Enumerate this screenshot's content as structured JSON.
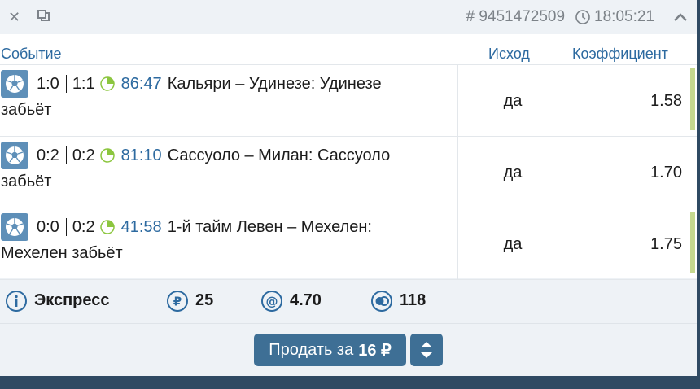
{
  "header": {
    "close_icon": "close-icon",
    "copy_icon": "copy-icon",
    "bet_id": "# 9451472509",
    "time": "18:05:21",
    "collapse_icon": "chevron-up-icon"
  },
  "columns": {
    "event": "Событие",
    "outcome": "Исход",
    "coefficient": "Коэффициент"
  },
  "rows": [
    {
      "score1": "1:0",
      "score2": "1:1",
      "minute": "86:47",
      "title": "Кальяри – Удинезе: Удинезе",
      "title2": "забьёт",
      "outcome": "да",
      "coef": "1.58"
    },
    {
      "score1": "0:2",
      "score2": "0:2",
      "minute": "81:10",
      "title": "Сассуоло – Милан: Сассуоло",
      "title2": "забьёт",
      "outcome": "да",
      "coef": "1.70"
    },
    {
      "score1": "0:0",
      "score2": "0:2",
      "minute": "41:58",
      "title": "1-й тайм Левен – Мехелен:",
      "title2": "Мехелен забьёт",
      "outcome": "да",
      "coef": "1.75"
    }
  ],
  "footer": {
    "type": "Экспресс",
    "stake": "25",
    "total_coef": "4.70",
    "count": "118"
  },
  "actions": {
    "sell_label": "Продать за",
    "sell_amount": "16 ₽"
  },
  "colors": {
    "accent": "#2d6aa0",
    "button": "#3e6f95",
    "coef_bar": "#c5d88e"
  }
}
